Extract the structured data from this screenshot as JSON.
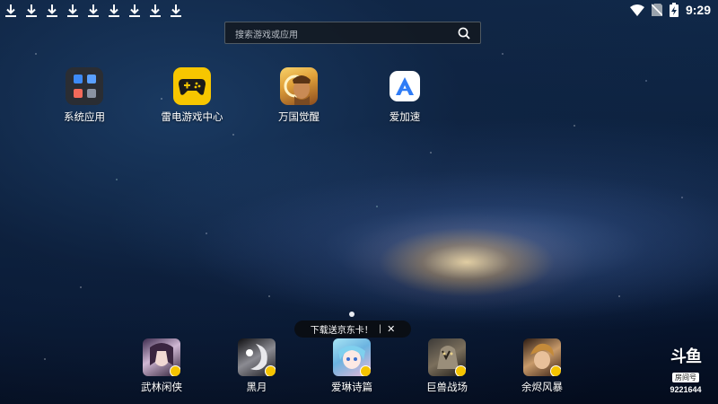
{
  "status_bar": {
    "download_icons": [
      "download-icon",
      "download-icon",
      "download-icon",
      "download-icon",
      "download-icon",
      "download-icon",
      "download-icon",
      "download-icon",
      "download-icon"
    ],
    "time": "9:29",
    "icons": [
      "wifi-icon",
      "no-sim-icon",
      "battery-charging-icon"
    ]
  },
  "search": {
    "placeholder": "搜索游戏或应用",
    "icon": "search-icon"
  },
  "home_apps": [
    {
      "label": "系统应用",
      "icon": "system-apps-folder-icon"
    },
    {
      "label": "雷电游戏中心",
      "icon": "gamepad-icon"
    },
    {
      "label": "万国觉醒",
      "icon": "game-warrior-icon"
    },
    {
      "label": "爱加速",
      "icon": "accelerator-a-icon"
    }
  ],
  "promo": {
    "text": "下载送京东卡！",
    "separator": "|",
    "close": "✕"
  },
  "dock_apps": [
    {
      "label": "武林闲侠"
    },
    {
      "label": "黑月"
    },
    {
      "label": "爱琳诗篇"
    },
    {
      "label": "巨兽战场"
    },
    {
      "label": "余烬风暴"
    }
  ],
  "watermark": {
    "logo": "斗鱼",
    "tag": "房间号",
    "room": "9221644"
  },
  "colors": {
    "accent_yellow": "#f7c600",
    "background_deep": "#0b1f3c"
  }
}
